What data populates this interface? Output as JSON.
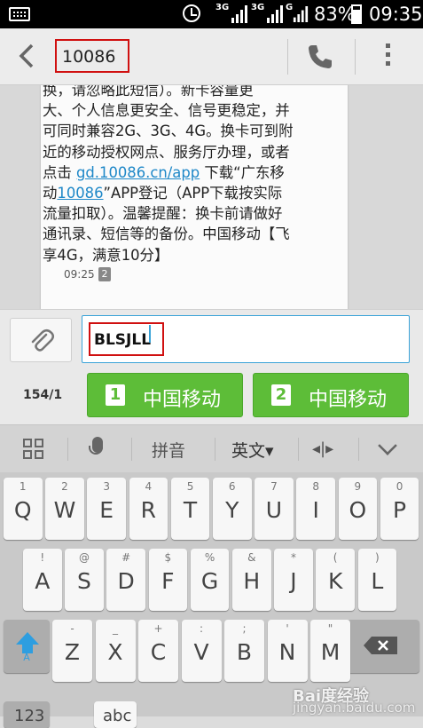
{
  "status_bar": {
    "net1": "3G",
    "net2": "3G",
    "net3": "G",
    "battery": "83%",
    "time": "09:35"
  },
  "header": {
    "contact": "10086"
  },
  "message": {
    "lines": [
      "换，请忽略此短信）。新卡容量更",
      "大、个人信息更安全、信号更稳定，并",
      "可同时兼容2G、3G、4G。换卡可到附",
      "近的移动授权网点、服务厅办理，或者",
      "流量扣取）。温馨提醒：换卡前请做好",
      "通讯录、短信等的备份。中国移动【飞",
      "享4G，满意10分】"
    ],
    "line5_prefix": "点击",
    "link_url": "gd.10086.cn/app",
    "line5_suffix": "下载“广东移",
    "line6_prefix": "动",
    "link_num": "10086",
    "line6_suffix": "”APP登记（APP下载按实际",
    "time": "09:25",
    "sim_badge": "2"
  },
  "compose": {
    "input_value": "BLSJLL",
    "counter": "154/1",
    "sim1_num": "1",
    "sim1_label": "中国移动",
    "sim2_num": "2",
    "sim2_label": "中国移动"
  },
  "kb_toolbar": {
    "pinyin": "拼音",
    "english": "英文▾"
  },
  "keyboard": {
    "row1": [
      [
        "1",
        "Q"
      ],
      [
        "2",
        "W"
      ],
      [
        "3",
        "E"
      ],
      [
        "4",
        "R"
      ],
      [
        "5",
        "T"
      ],
      [
        "6",
        "Y"
      ],
      [
        "7",
        "U"
      ],
      [
        "8",
        "I"
      ],
      [
        "9",
        "O"
      ],
      [
        "0",
        "P"
      ]
    ],
    "row2": [
      [
        "!",
        "A"
      ],
      [
        "@",
        "S"
      ],
      [
        "#",
        "D"
      ],
      [
        "$",
        "F"
      ],
      [
        "%",
        "G"
      ],
      [
        "&",
        "H"
      ],
      [
        "*",
        "J"
      ],
      [
        "(",
        "K"
      ],
      [
        ")",
        "L"
      ]
    ],
    "row3": [
      [
        "-",
        "Z"
      ],
      [
        "_",
        "X"
      ],
      [
        "+",
        "C"
      ],
      [
        ":",
        "V"
      ],
      [
        ";",
        "B"
      ],
      [
        "'",
        "N"
      ],
      [
        "\"",
        "M"
      ]
    ],
    "shift_label": "A",
    "bottom_left": "123",
    "bottom_abc": "abc"
  },
  "watermark": {
    "brand": "Bai度经验",
    "url": "jingyan.baidu.com"
  }
}
